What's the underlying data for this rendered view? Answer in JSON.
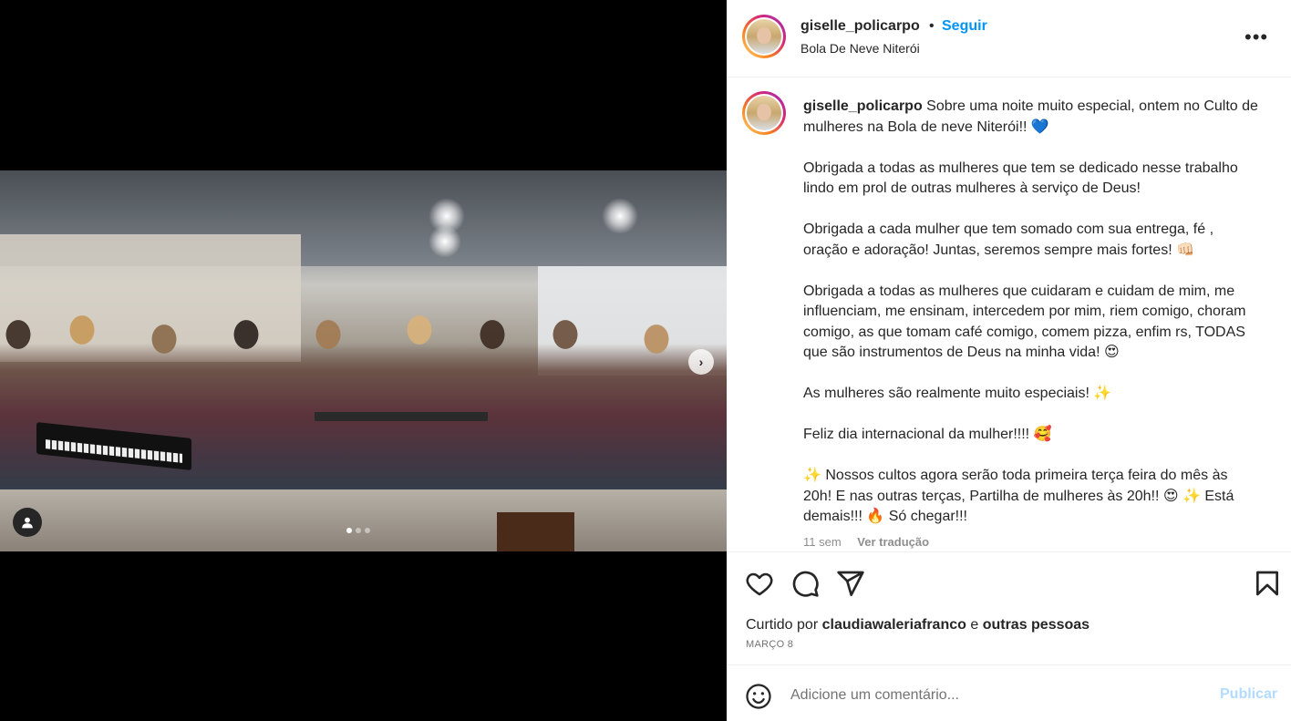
{
  "post": {
    "username": "giselle_policarpo",
    "separator": "•",
    "follow_label": "Seguir",
    "location": "Bola De Neve Niterói",
    "more_label": "•••"
  },
  "media": {
    "next_label": "›",
    "slides_count": 3,
    "active_slide": 1
  },
  "caption": {
    "username": "giselle_policarpo",
    "text": " Sobre uma noite muito especial, ontem no Culto de mulheres na Bola de neve Niterói!! 💙\n\nObrigada a todas as mulheres que tem se dedicado nesse trabalho lindo em prol de outras mulheres à serviço de Deus!\n\nObrigada a cada mulher que tem somado com sua entrega, fé , oração e adoração! Juntas, seremos sempre mais fortes! 👊🏻\n\nObrigada a todas as mulheres que cuidaram e cuidam de mim, me influenciam, me ensinam, intercedem por mim, riem comigo, choram comigo, as que tomam café comigo, comem pizza, enfim rs, TODAS que são instrumentos de Deus na minha vida! 😍\n\nAs mulheres são realmente muito especiais! ✨\n\nFeliz dia internacional da mulher!!!! 🥰\n\n✨ Nossos cultos agora serão toda primeira terça feira do mês às 20h! E nas outras terças, Partilha de mulheres às 20h!! 😍 ✨ Está demais!!! 🔥 Só chegar!!!",
    "time": "11 sem",
    "translate_label": "Ver tradução"
  },
  "likes": {
    "prefix": "Curtido por ",
    "user": "claudiawaleriafranco",
    "conj": " e ",
    "others": "outras pessoas"
  },
  "date": "MARÇO 8",
  "comment_box": {
    "placeholder": "Adicione um comentário...",
    "publish_label": "Publicar"
  },
  "colors": {
    "accent": "#0095f6",
    "publish_disabled": "#b3dbff",
    "text": "#262626",
    "secondary": "#737373"
  }
}
